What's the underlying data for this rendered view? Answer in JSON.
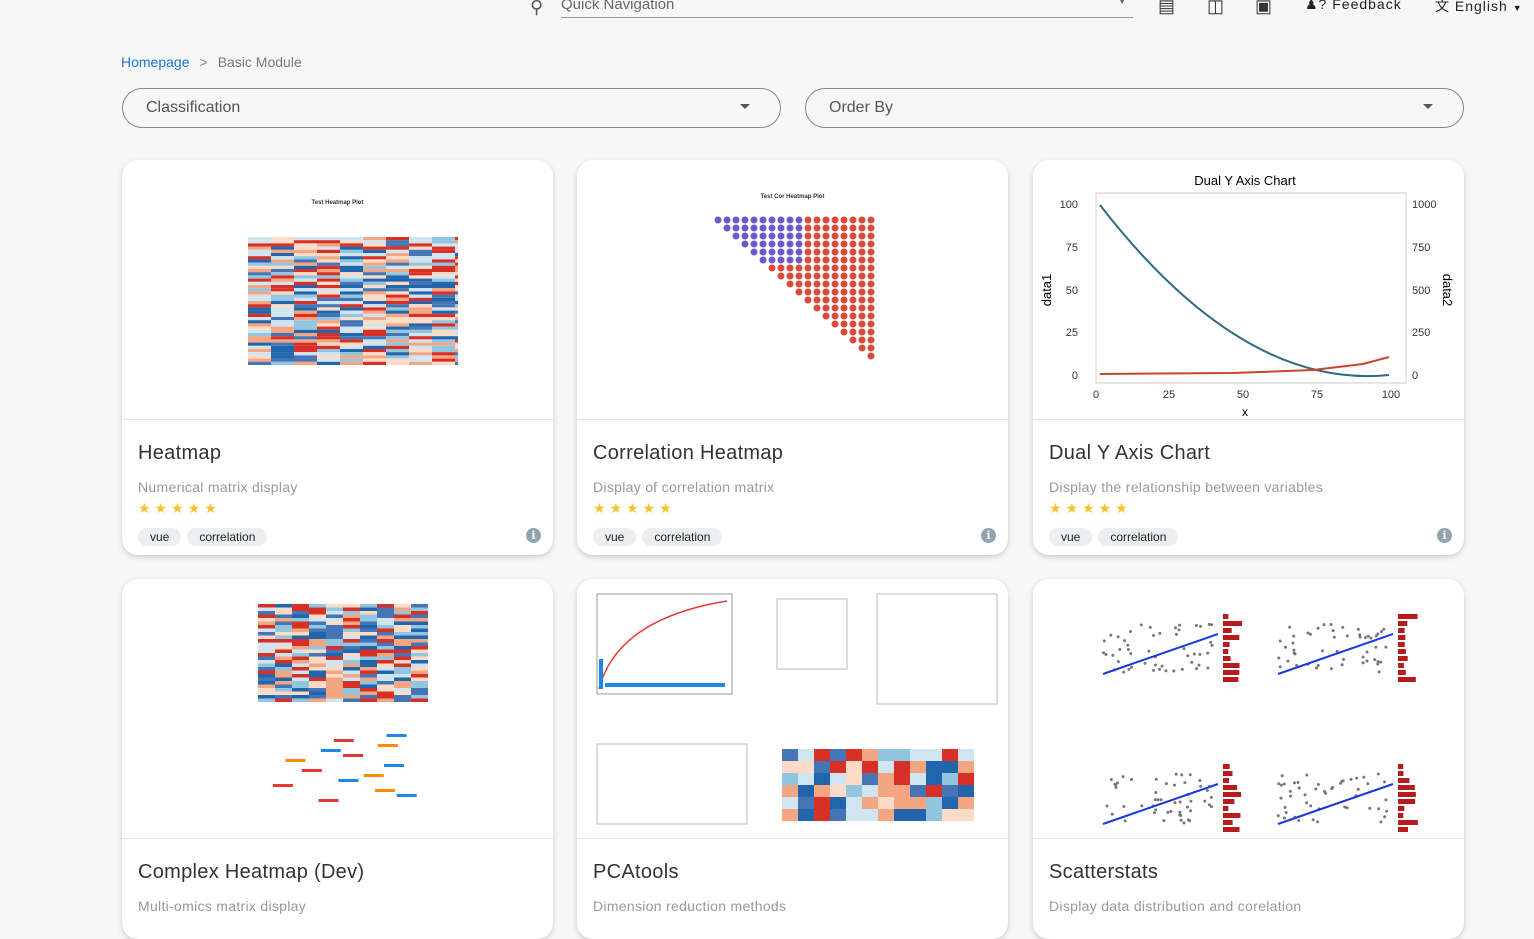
{
  "topbar": {
    "search_placeholder": "Quick Navigation",
    "feedback": "Feedback",
    "language": "English"
  },
  "breadcrumb": {
    "home": "Homepage",
    "separator": ">",
    "current": "Basic Module"
  },
  "filters": {
    "classification": "Classification",
    "order_by": "Order By"
  },
  "colors": {
    "accent": "#1976d2",
    "star": "#fbc02d"
  },
  "cards": [
    {
      "title": "Heatmap",
      "desc": "Numerical matrix display",
      "rating": 5,
      "tags": [
        "vue",
        "correlation"
      ],
      "thumb_title": "Test Heatmap Plot"
    },
    {
      "title": "Correlation Heatmap",
      "desc": "Display of correlation matrix",
      "rating": 5,
      "tags": [
        "vue",
        "correlation"
      ],
      "thumb_title": "Test Cor Heatmap Plot"
    },
    {
      "title": "Dual Y Axis Chart",
      "desc": "Display the relationship between variables",
      "rating": 5,
      "tags": [
        "vue",
        "correlation"
      ],
      "thumb_title": "Dual Y Axis Chart",
      "thumb_xlabel": "x",
      "thumb_y1label": "data1",
      "thumb_y2label": "data2"
    },
    {
      "title": "Complex Heatmap (Dev)",
      "desc": "Multi-omics matrix display"
    },
    {
      "title": "PCAtools",
      "desc": "Dimension reduction methods"
    },
    {
      "title": "Scatterstats",
      "desc": "Display data distribution and corelation"
    }
  ]
}
